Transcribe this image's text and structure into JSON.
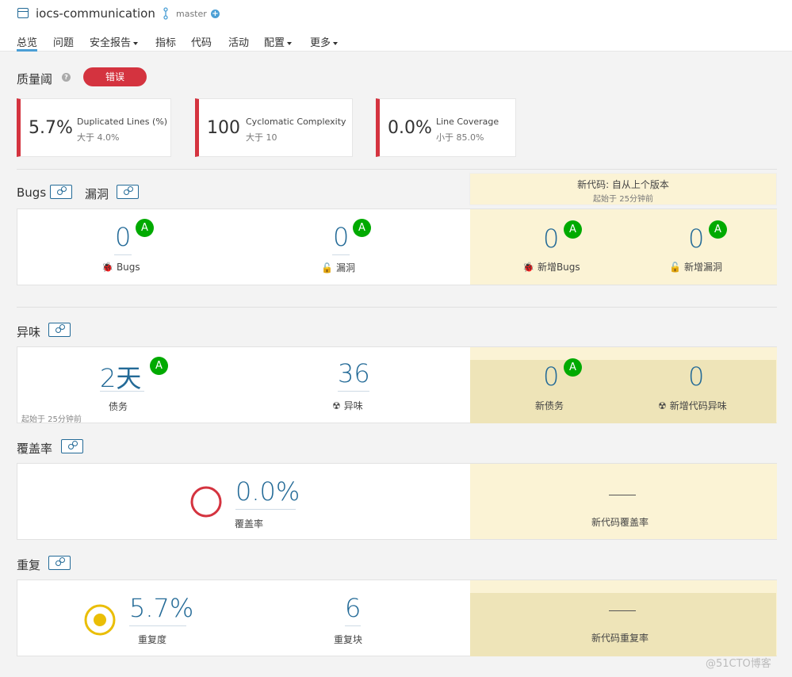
{
  "header": {
    "project": "iocs-communication",
    "branch": "master",
    "add_icon": "plus-icon"
  },
  "nav": [
    {
      "label": "总览",
      "active": true,
      "dropdown": false
    },
    {
      "label": "问题",
      "dropdown": false
    },
    {
      "label": "安全报告",
      "dropdown": true
    },
    {
      "label": "指标",
      "dropdown": false
    },
    {
      "label": "代码",
      "dropdown": false
    },
    {
      "label": "活动",
      "dropdown": false
    },
    {
      "label": "配置",
      "dropdown": true
    },
    {
      "label": "更多",
      "dropdown": true
    }
  ],
  "quality_gate": {
    "title": "质量阈",
    "status": "错误",
    "status_color": "#d4333f",
    "conditions": [
      {
        "value": "5.7%",
        "metric": "Duplicated Lines (%)",
        "threshold": "大于 4.0%"
      },
      {
        "value": "100",
        "metric": "Cyclomatic Complexity",
        "threshold": "大于 10"
      },
      {
        "value": "0.0%",
        "metric": "Line Coverage",
        "threshold": "小于 85.0%"
      }
    ]
  },
  "new_code": {
    "title": "新代码: 自从上个版本",
    "since": "起始于 25分钟前"
  },
  "bugs_section": {
    "title_bugs": "Bugs",
    "title_vuln": "漏洞",
    "bugs": {
      "value": "0",
      "rating": "A",
      "label": "Bugs"
    },
    "vulnerabilities": {
      "value": "0",
      "rating": "A",
      "label": "漏洞"
    },
    "new_bugs": {
      "value": "0",
      "rating": "A",
      "label": "新增Bugs"
    },
    "new_vulnerabilities": {
      "value": "0",
      "rating": "A",
      "label": "新增漏洞"
    }
  },
  "smells_section": {
    "title": "异味",
    "debt": {
      "value": "2天",
      "rating": "A",
      "label": "债务",
      "note": "起始于 25分钟前"
    },
    "smells": {
      "value": "36",
      "label": "异味"
    },
    "new_debt": {
      "value": "0",
      "rating": "A",
      "label": "新债务"
    },
    "new_smells": {
      "value": "0",
      "label": "新增代码异味"
    }
  },
  "coverage_section": {
    "title": "覆盖率",
    "coverage": {
      "value": "0.0%",
      "label": "覆盖率"
    },
    "new_coverage": {
      "value": "—",
      "label": "新代码覆盖率"
    }
  },
  "duplication_section": {
    "title": "重复",
    "density": {
      "value": "5.7%",
      "label": "重复度"
    },
    "blocks": {
      "value": "6",
      "label": "重复块"
    },
    "new_density": {
      "value": "—",
      "label": "新代码重复率"
    }
  },
  "watermark": "@51CTO博客",
  "colors": {
    "accent": "#236a97",
    "error": "#d4333f",
    "rating_a": "#00aa00",
    "new_code_bg": "#fbf3d5"
  }
}
